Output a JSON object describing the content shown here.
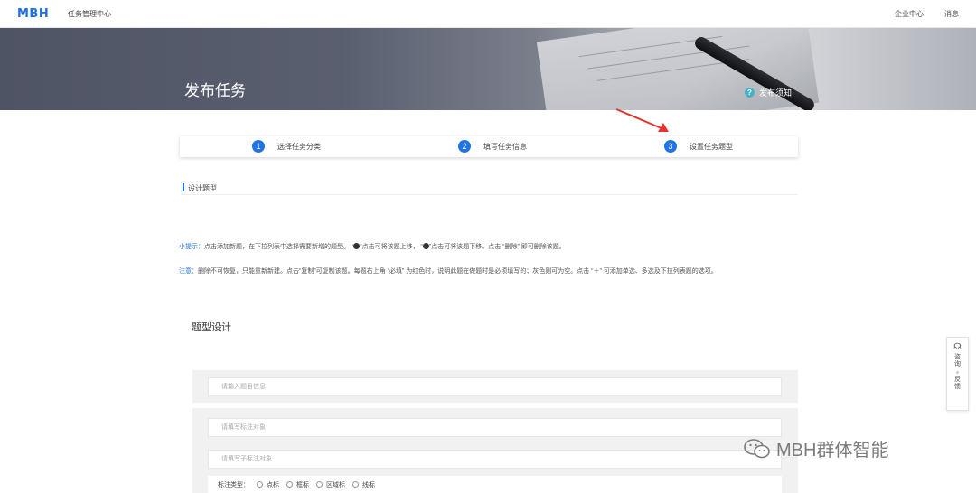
{
  "nav": {
    "logo": "MBH",
    "task_center": "任务管理中心",
    "enterprise_center": "企业中心",
    "messages": "消息"
  },
  "banner": {
    "title": "发布任务",
    "notice": "发布须知"
  },
  "steps": [
    {
      "num": "1",
      "label": "选择任务分类"
    },
    {
      "num": "2",
      "label": "填写任务信息"
    },
    {
      "num": "3",
      "label": "设置任务题型"
    }
  ],
  "section": {
    "title": "设计题型"
  },
  "tips": {
    "tip_label": "小提示：",
    "tip_text1": "点击添加新题，在下拉列表中选择需要新增的题型。 “",
    "tip_text2": "”点击可将该题上移， “",
    "tip_text3": "”点击可将该题下移。点击 “删除” 即可删除该题。",
    "note_label": "注意：",
    "note_text": "删除不可恢复，只能重新新建。点击“复制”可复制该题。每题右上角 “必填” 为红色时，说明此题在做题时是必须填写的；灰色则可为空。点击 “＋” 可添加单选、多选及下拉列表题的选项。"
  },
  "design": {
    "title": "题型设计",
    "question_placeholder": "请输入题目信息",
    "target_placeholder": "请填写标注对象",
    "sub_target_placeholder": "请填写子标注对象",
    "type_label": "标注类型：",
    "type_options": [
      "点标",
      "框标",
      "区域标",
      "线标"
    ]
  },
  "side": {
    "consult": "咨询",
    "feedback": "反馈"
  },
  "watermark": "MBH群体智能",
  "colors": {
    "accent": "#1e74e8",
    "arrow": "#e8322f"
  }
}
